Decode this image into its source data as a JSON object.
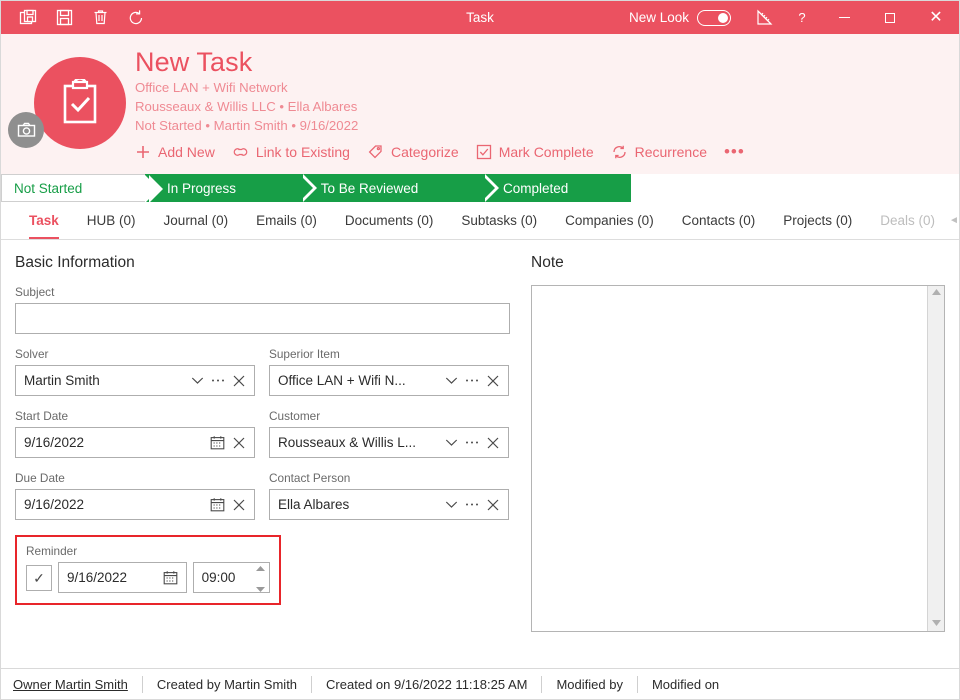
{
  "titlebar": {
    "title": "Task",
    "tools": [
      {
        "name": "save-and-new-icon",
        "label": "Save and New"
      },
      {
        "name": "save-icon",
        "label": "Save"
      },
      {
        "name": "delete-icon",
        "label": "Delete"
      },
      {
        "name": "refresh-icon",
        "label": "Refresh"
      }
    ],
    "new_look_label": "New Look",
    "new_look_on": true,
    "design_icon": "ruler-pencil-icon",
    "help_label": "?",
    "minimize_label": "Minimize",
    "maximize_label": "Maximize",
    "close_label": "✕",
    "accent": "#eb5160"
  },
  "header": {
    "title": "New Task",
    "subtitle_1": "Office LAN + Wifi Network",
    "subtitle_2": "Rousseaux & Willis LLC • Ella Albares",
    "subtitle_3": "Not Started • Martin Smith • 9/16/2022",
    "avatar_icon": "clipboard-check-icon",
    "camera_badge_icon": "camera-icon",
    "actions": [
      {
        "icon": "plus-icon",
        "label": "Add New"
      },
      {
        "icon": "link-icon",
        "label": "Link to Existing"
      },
      {
        "icon": "tag-icon",
        "label": "Categorize"
      },
      {
        "icon": "checkbox-icon",
        "label": "Mark Complete"
      },
      {
        "icon": "recurrence-icon",
        "label": "Recurrence"
      },
      {
        "icon": "more-icon",
        "label": "•••"
      }
    ]
  },
  "flow": {
    "active_color": "#ffffff",
    "done_color": "#179e47",
    "steps": [
      {
        "label": "Not Started",
        "active": true
      },
      {
        "label": "In Progress",
        "active": false
      },
      {
        "label": "To Be Reviewed",
        "active": false
      },
      {
        "label": "Completed",
        "active": false
      }
    ]
  },
  "tabs": {
    "items": [
      {
        "label": "Task",
        "active": true
      },
      {
        "label": "HUB (0)",
        "active": false
      },
      {
        "label": "Journal (0)",
        "active": false
      },
      {
        "label": "Emails (0)",
        "active": false
      },
      {
        "label": "Documents (0)",
        "active": false
      },
      {
        "label": "Subtasks (0)",
        "active": false
      },
      {
        "label": "Companies (0)",
        "active": false
      },
      {
        "label": "Contacts (0)",
        "active": false
      },
      {
        "label": "Projects (0)",
        "active": false
      },
      {
        "label": "Deals (0)",
        "active": false
      }
    ],
    "scroll_left": "◄",
    "scroll_right": "►"
  },
  "form": {
    "section_title": "Basic Information",
    "subject": {
      "label": "Subject",
      "value": "",
      "placeholder": ""
    },
    "solver": {
      "label": "Solver",
      "value": "Martin Smith"
    },
    "superior_item": {
      "label": "Superior Item",
      "value": "Office LAN + Wifi N..."
    },
    "start_date": {
      "label": "Start Date",
      "value": "9/16/2022"
    },
    "customer": {
      "label": "Customer",
      "value": "Rousseaux & Willis L..."
    },
    "due_date": {
      "label": "Due Date",
      "value": "9/16/2022"
    },
    "contact_person": {
      "label": "Contact Person",
      "value": "Ella Albares"
    },
    "reminder": {
      "label": "Reminder",
      "checked": true,
      "check_glyph": "✓",
      "date": "9/16/2022",
      "time": "09:00",
      "highlight_color": "#e8252a"
    },
    "icons": {
      "dropdown": "chevron-down-icon",
      "ellipsis": "ellipsis-icon",
      "clear": "clear-x-icon",
      "calendar": "calendar-icon",
      "spinner_up": "spinner-up-icon",
      "spinner_down": "spinner-down-icon"
    }
  },
  "note": {
    "title": "Note",
    "value": "",
    "scroll_up": "▲",
    "scroll_down": "▼"
  },
  "statusbar": {
    "owner": "Owner Martin Smith",
    "created_by": "Created by Martin Smith",
    "created_on": "Created on 9/16/2022 11:18:25 AM",
    "modified_by": "Modified by",
    "modified_on": "Modified on"
  }
}
